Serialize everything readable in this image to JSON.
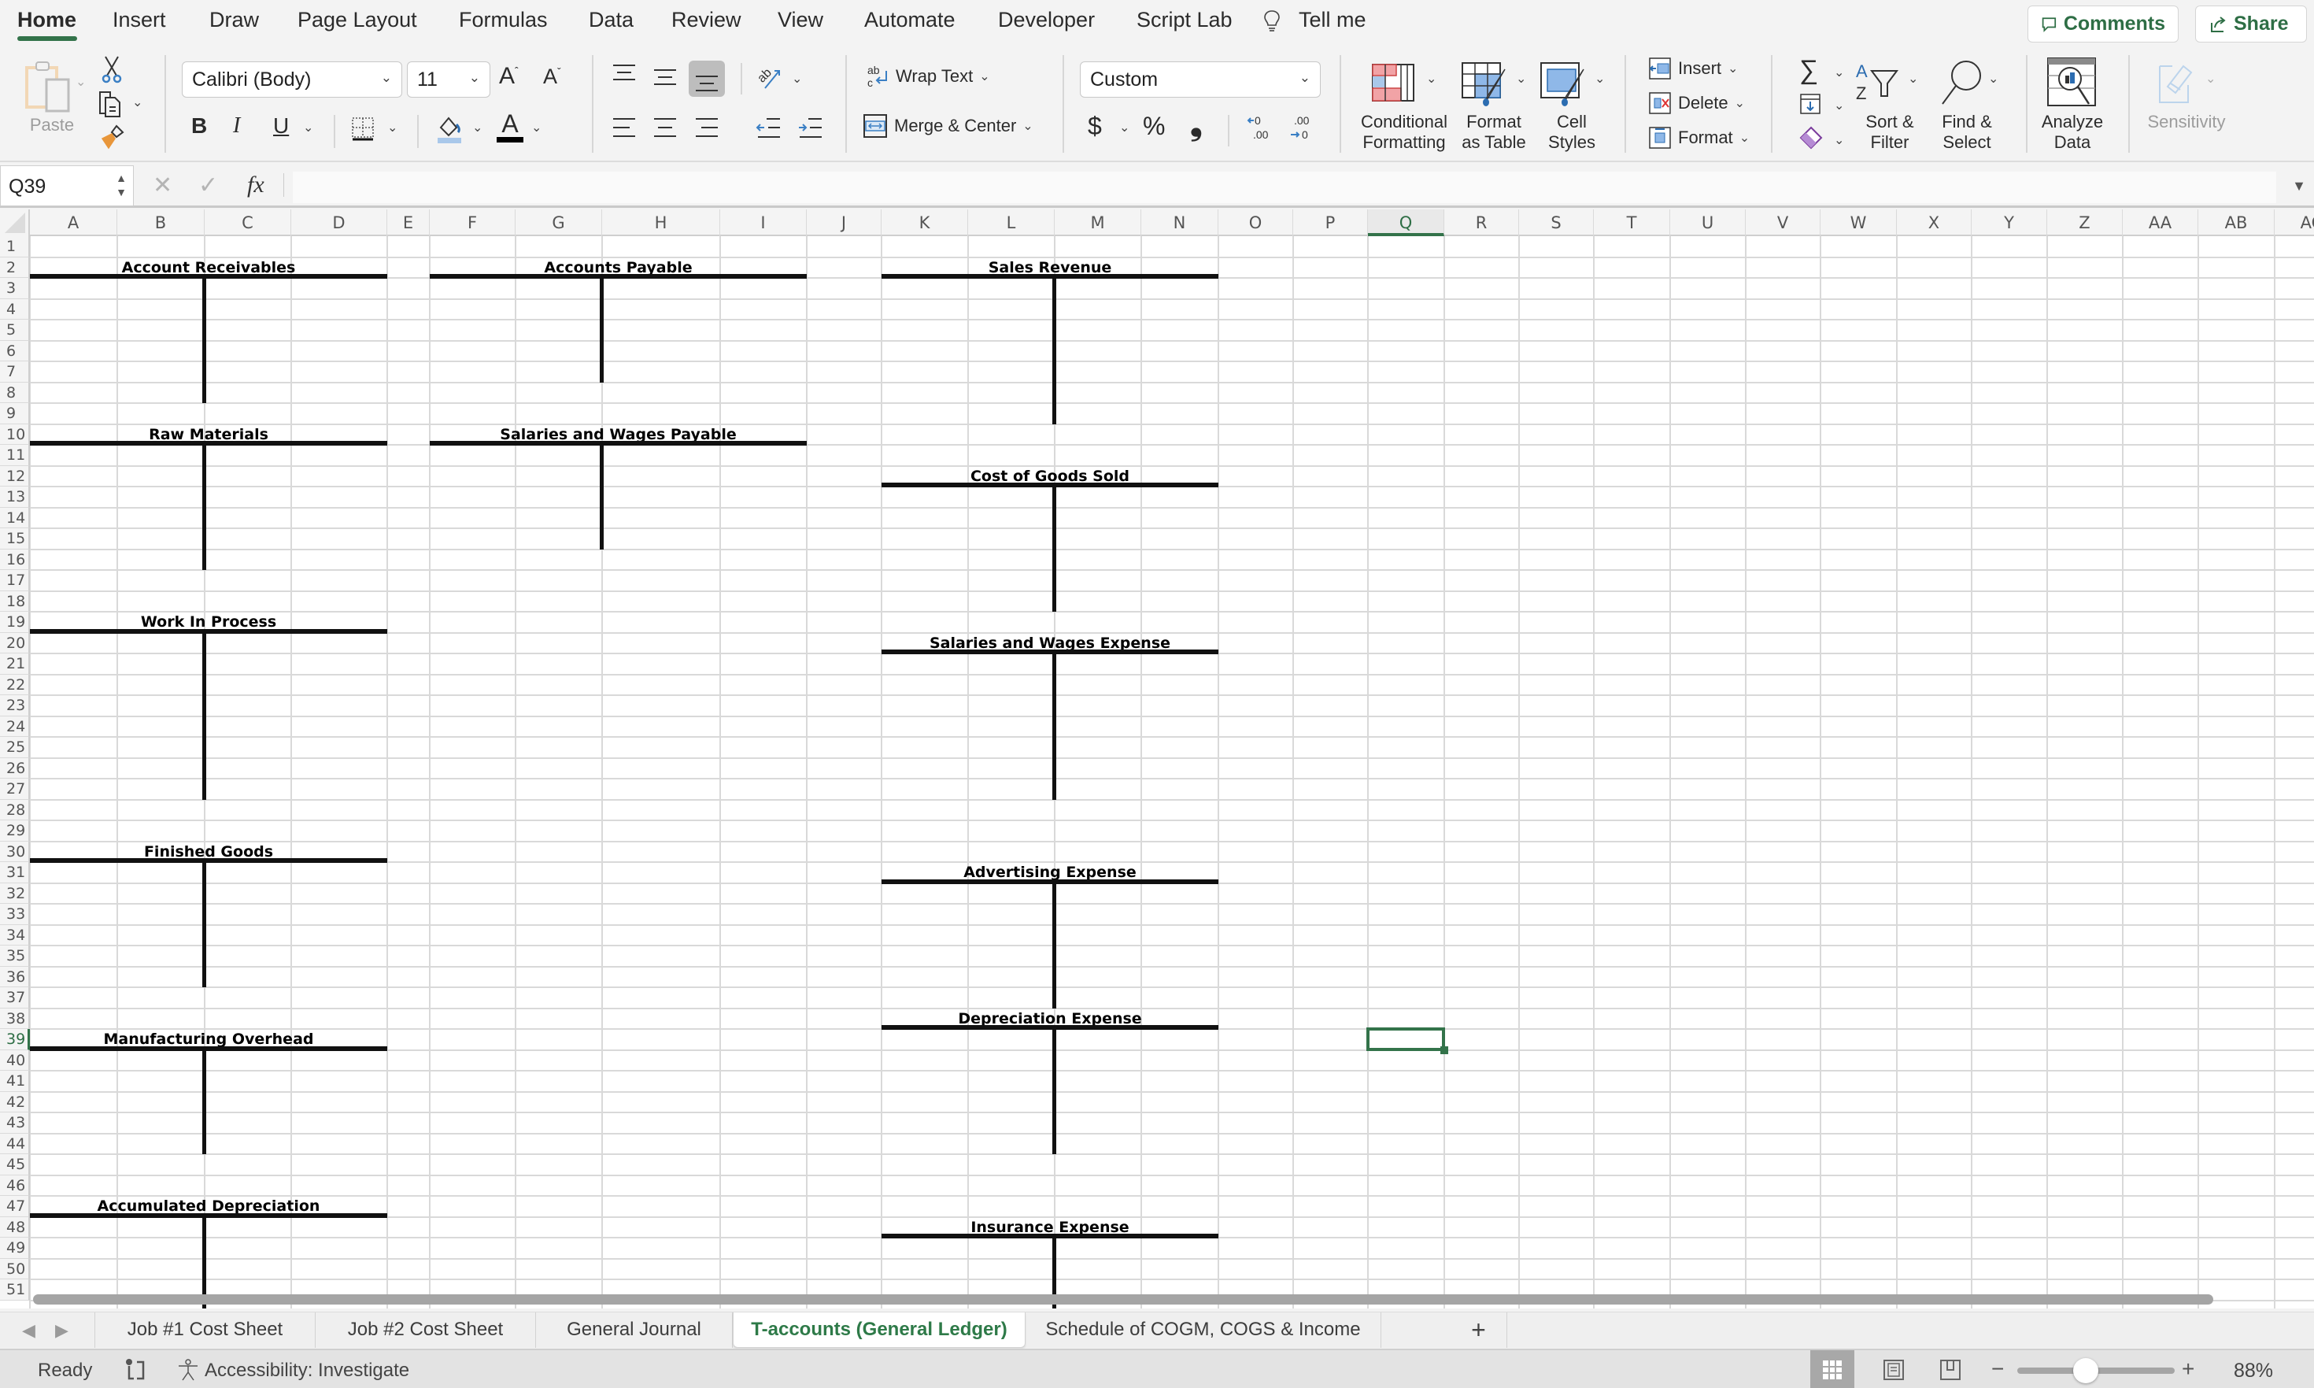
{
  "menu": {
    "tabs": [
      {
        "label": "Home",
        "active": true
      },
      {
        "label": "Insert"
      },
      {
        "label": "Draw"
      },
      {
        "label": "Page Layout"
      },
      {
        "label": "Formulas"
      },
      {
        "label": "Data"
      },
      {
        "label": "Review"
      },
      {
        "label": "View"
      },
      {
        "label": "Automate"
      },
      {
        "label": "Developer"
      },
      {
        "label": "Script Lab"
      }
    ],
    "tell_me": "Tell me",
    "comments": "Comments",
    "share": "Share"
  },
  "ribbon": {
    "paste": "Paste",
    "font_name": "Calibri (Body)",
    "font_size": "11",
    "bold": "B",
    "italic": "I",
    "underline": "U",
    "wrap_text": "Wrap Text",
    "merge_center": "Merge & Center",
    "number_format": "Custom",
    "currency": "$",
    "percent": "%",
    "comma": "❟",
    "conditional_formatting": [
      "Conditional",
      "Formatting"
    ],
    "format_as_table": [
      "Format",
      "as Table"
    ],
    "cell_styles": [
      "Cell",
      "Styles"
    ],
    "insert": "Insert",
    "delete": "Delete",
    "format": "Format",
    "sort_filter": [
      "Sort &",
      "Filter"
    ],
    "find_select": [
      "Find &",
      "Select"
    ],
    "analyze_data": [
      "Analyze",
      "Data"
    ],
    "sensitivity": "Sensitivity",
    "accent_green": "#33734a"
  },
  "formula_bar": {
    "name_box": "Q39",
    "fx": "fx",
    "formula": ""
  },
  "sheet": {
    "columns": [
      "A",
      "B",
      "C",
      "D",
      "E",
      "F",
      "G",
      "H",
      "I",
      "J",
      "K",
      "L",
      "M",
      "N",
      "O",
      "P",
      "Q",
      "R",
      "S",
      "T",
      "U",
      "V",
      "W",
      "X",
      "Y",
      "Z",
      "AA",
      "AB",
      "AC"
    ],
    "visible_rows": [
      1,
      2,
      3,
      4,
      5,
      6,
      7,
      8,
      9,
      10,
      11,
      12,
      13,
      14,
      15,
      16,
      17,
      18,
      19,
      20,
      21,
      22,
      23,
      24,
      25,
      26,
      27,
      28,
      29,
      30,
      31,
      32,
      33,
      34,
      35,
      36,
      37,
      38,
      39,
      40,
      41,
      42,
      43,
      44,
      45,
      46,
      47,
      48,
      49,
      50,
      51
    ],
    "selected_cell": {
      "column": "Q",
      "row": 39
    },
    "t_accounts": [
      {
        "title": "Account Receivables",
        "cols": [
          "A",
          "D"
        ],
        "title_row": 2,
        "last_row": 8
      },
      {
        "title": "Accounts Payable",
        "cols": [
          "F",
          "I"
        ],
        "title_row": 2,
        "last_row": 7
      },
      {
        "title": "Sales Revenue",
        "cols": [
          "K",
          "N"
        ],
        "title_row": 2,
        "last_row": 9
      },
      {
        "title": "Raw Materials",
        "cols": [
          "A",
          "D"
        ],
        "title_row": 10,
        "last_row": 16
      },
      {
        "title": "Salaries and Wages Payable",
        "cols": [
          "F",
          "I"
        ],
        "title_row": 10,
        "last_row": 15
      },
      {
        "title": "Cost of Goods Sold",
        "cols": [
          "K",
          "N"
        ],
        "title_row": 12,
        "last_row": 18
      },
      {
        "title": "Work In Process",
        "cols": [
          "A",
          "D"
        ],
        "title_row": 19,
        "last_row": 27
      },
      {
        "title": "Salaries and Wages Expense",
        "cols": [
          "K",
          "N"
        ],
        "title_row": 20,
        "last_row": 27
      },
      {
        "title": "Finished Goods",
        "cols": [
          "A",
          "D"
        ],
        "title_row": 30,
        "last_row": 36
      },
      {
        "title": "Advertising Expense",
        "cols": [
          "K",
          "N"
        ],
        "title_row": 31,
        "last_row": 37
      },
      {
        "title": "Depreciation Expense",
        "cols": [
          "K",
          "N"
        ],
        "title_row": 38,
        "last_row": 44
      },
      {
        "title": "Manufacturing Overhead",
        "cols": [
          "A",
          "D"
        ],
        "title_row": 39,
        "last_row": 44
      },
      {
        "title": "Accumulated Depreciation",
        "cols": [
          "A",
          "D"
        ],
        "title_row": 47,
        "last_row": 52
      },
      {
        "title": "Insurance Expense",
        "cols": [
          "K",
          "N"
        ],
        "title_row": 48,
        "last_row": 52
      }
    ]
  },
  "sheet_tabs": [
    {
      "label": "Job #1 Cost Sheet"
    },
    {
      "label": "Job #2 Cost Sheet"
    },
    {
      "label": "General Journal"
    },
    {
      "label": "T-accounts (General Ledger)",
      "active": true
    },
    {
      "label": "Schedule of COGM, COGS & Income"
    }
  ],
  "status_bar": {
    "ready": "Ready",
    "accessibility": "Accessibility: Investigate",
    "zoom_percent": "88%",
    "zoom_value": 88
  }
}
